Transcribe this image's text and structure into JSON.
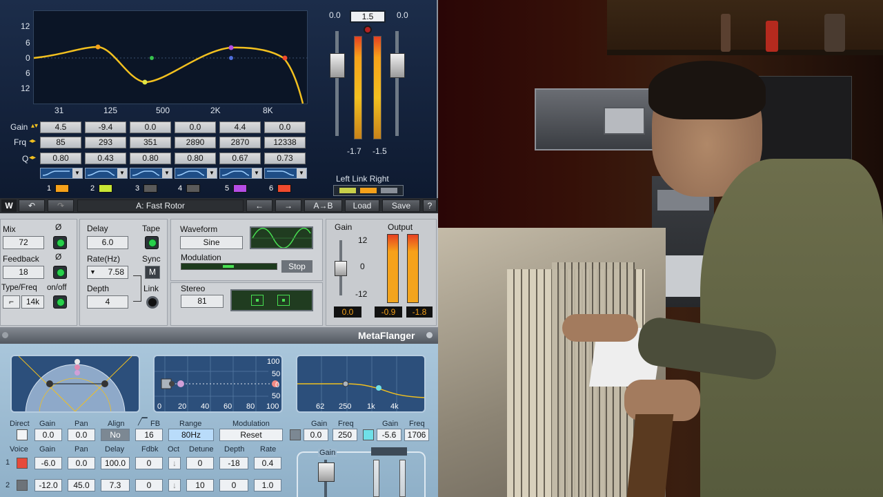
{
  "eq": {
    "gain_axis": [
      "12",
      "6",
      "0",
      "6",
      "12"
    ],
    "freq_axis": [
      "31",
      "125",
      "500",
      "2K",
      "8K"
    ],
    "meter_left_top": "0.0",
    "meter_center_value": "1.5",
    "meter_right_top": "0.0",
    "meter_left_bottom": "-1.7",
    "meter_right_bottom": "-1.5",
    "row_labels": {
      "gain": "Gain",
      "freq": "Frq",
      "q": "Q"
    },
    "gain": [
      "4.5",
      "-9.4",
      "0.0",
      "0.0",
      "4.4",
      "0.0"
    ],
    "freq": [
      "85",
      "293",
      "351",
      "2890",
      "2870",
      "12338"
    ],
    "q": [
      "0.80",
      "0.43",
      "0.80",
      "0.80",
      "0.67",
      "0.73"
    ],
    "bands": [
      "1",
      "2",
      "3",
      "4",
      "5",
      "6"
    ],
    "band_colors": [
      "#f5a11a",
      "#c8e635",
      "#5a5a5a",
      "#5a5a5a",
      "#b54de6",
      "#f04a2e"
    ],
    "link_label": "Left Link Right"
  },
  "toolbar": {
    "preset": "A: Fast Rotor",
    "ab": "A→B",
    "load": "Load",
    "save": "Save",
    "help": "?"
  },
  "flanger": {
    "mix_label": "Mix",
    "mix_value": "72",
    "feedback_label": "Feedback",
    "feedback_value": "18",
    "typefreq_label": "Type/Freq",
    "onoff_label": "on/off",
    "type_value": "14k",
    "phase_symbol": "Ø",
    "delay_label": "Delay",
    "delay_value": "6.0",
    "tape_label": "Tape",
    "rate_label": "Rate(Hz)",
    "rate_value": "7.58",
    "sync_label": "Sync",
    "sync_value": "M",
    "depth_label": "Depth",
    "depth_value": "4",
    "link_label": "Link",
    "waveform_label": "Waveform",
    "waveform_value": "Sine",
    "modulation_label": "Modulation",
    "stop_label": "Stop",
    "stereo_label": "Stereo",
    "stereo_value": "81",
    "gain_label": "Gain",
    "gain_scale": [
      "12",
      "0",
      "-12"
    ],
    "gain_value": "0.0",
    "output_label": "Output",
    "output_left": "-0.9",
    "output_right": "-1.8"
  },
  "brand": "MetaFlanger",
  "bottom": {
    "scope2_y": [
      "100",
      "50",
      "0",
      "50"
    ],
    "scope2_x": [
      "0",
      "20",
      "40",
      "60",
      "80",
      "100"
    ],
    "scope3_x": [
      "62",
      "250",
      "1k",
      "4k"
    ],
    "hdr1": {
      "direct": "Direct",
      "gain": "Gain",
      "pan": "Pan",
      "align": "Align",
      "fb": "FB",
      "range": "Range",
      "modulation": "Modulation"
    },
    "row1": {
      "gain": "0.0",
      "pan": "0.0",
      "align": "No",
      "fb": "16",
      "range": "80Hz",
      "modulation": "Reset"
    },
    "filter_hdr": {
      "gain1": "Gain",
      "freq1": "Freq",
      "gain2": "Gain",
      "freq2": "Freq"
    },
    "filter_vals": {
      "gain1": "0.0",
      "freq1": "250",
      "gain2": "-5.6",
      "freq2": "1706"
    },
    "hdr2": {
      "voice": "Voice",
      "gain": "Gain",
      "pan": "Pan",
      "delay": "Delay",
      "fdbk": "Fdbk",
      "oct": "Oct",
      "detune": "Detune",
      "depth": "Depth",
      "rate": "Rate"
    },
    "voices": [
      {
        "num": "1",
        "gain": "-6.0",
        "pan": "0.0",
        "delay": "100.0",
        "fdbk": "0",
        "detune": "0",
        "depth": "-18",
        "rate": "0.4"
      },
      {
        "num": "2",
        "gain": "-12.0",
        "pan": "45.0",
        "delay": "7.3",
        "fdbk": "0",
        "detune": "10",
        "depth": "0",
        "rate": "1.0"
      }
    ],
    "gain_label": "Gain"
  }
}
